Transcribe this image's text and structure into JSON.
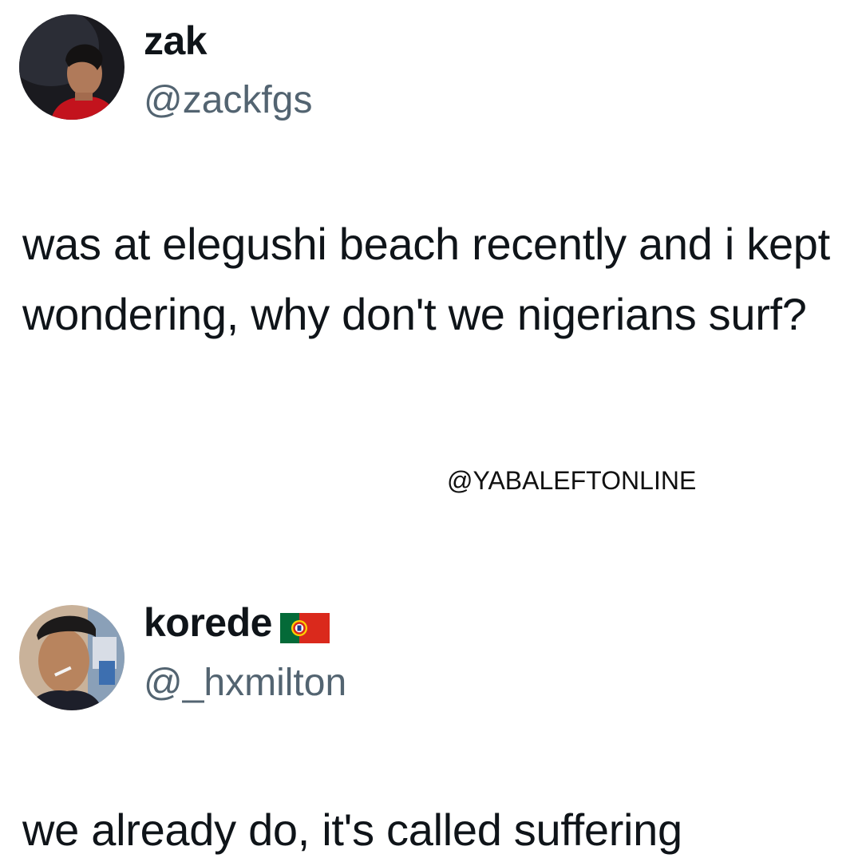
{
  "tweets": [
    {
      "display_name": "zak",
      "handle": "@zackfgs",
      "text": "was at elegushi beach recently and i kept wondering, why don't we nigerians surf?"
    },
    {
      "display_name": "korede",
      "display_name_flag": "portugal-flag-icon",
      "handle": "@_hxmilton",
      "text": "we already do, it's called suffering"
    }
  ],
  "watermark": "@YABALEFTONLINE",
  "colors": {
    "text": "#0f1419",
    "handle": "#536471",
    "background": "#ffffff"
  }
}
